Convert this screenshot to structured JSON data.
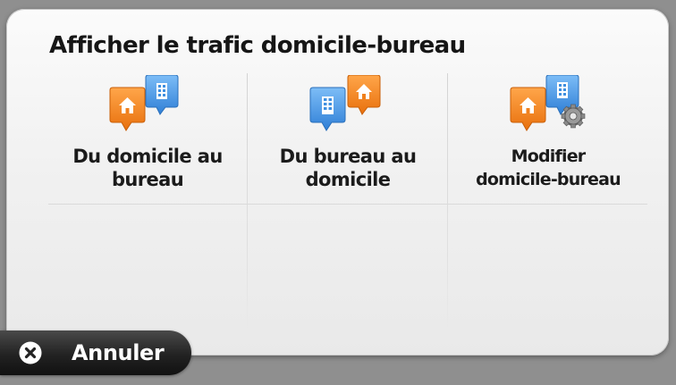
{
  "dialog": {
    "title": "Afficher le trafic domicile-bureau"
  },
  "options": [
    {
      "label": "Du domicile au\nbureau",
      "icon": "home-to-office-icon"
    },
    {
      "label": "Du bureau au\ndomicile",
      "icon": "office-to-home-icon"
    },
    {
      "label": "Modifier\ndomicile-bureau",
      "icon": "edit-home-office-icon"
    }
  ],
  "cancel": {
    "label": "Annuler",
    "icon": "close-icon"
  },
  "colors": {
    "home_pin": "#f0801c",
    "office_pin": "#3f8fe0",
    "cancel_bg": "#222222"
  }
}
